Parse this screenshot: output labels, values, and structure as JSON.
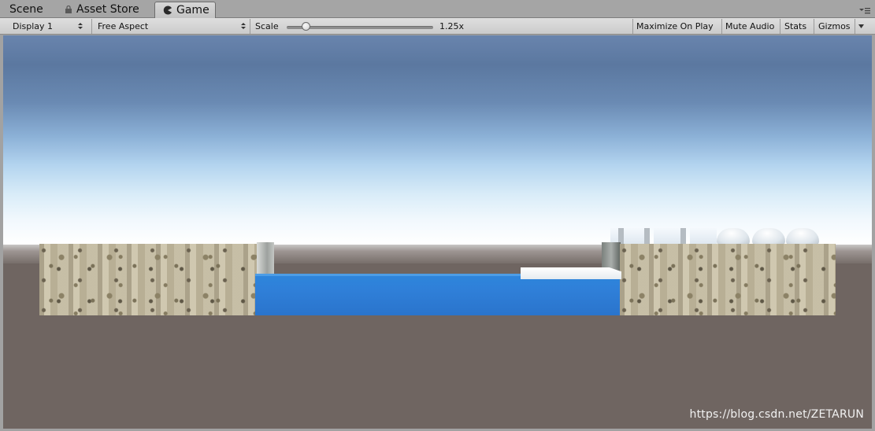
{
  "tabs": {
    "scene": "Scene",
    "asset_store": "Asset Store",
    "game": "Game",
    "icons": {
      "asset_store": "lock-icon",
      "game": "pacman-icon",
      "menu": "tab-menu-icon"
    }
  },
  "toolbar": {
    "display": "Display 1",
    "aspect": "Free Aspect",
    "scale_label": "Scale",
    "scale_value": "1.25x",
    "maximize_on_play": "Maximize On Play",
    "mute_audio": "Mute Audio",
    "stats": "Stats",
    "gizmos": "Gizmos"
  },
  "view": {
    "watermark": "https://blog.csdn.net/ZETARUN",
    "colors": {
      "water": "#2e86dc",
      "ground": "#6f6561",
      "sky_top": "#6984ad"
    }
  }
}
